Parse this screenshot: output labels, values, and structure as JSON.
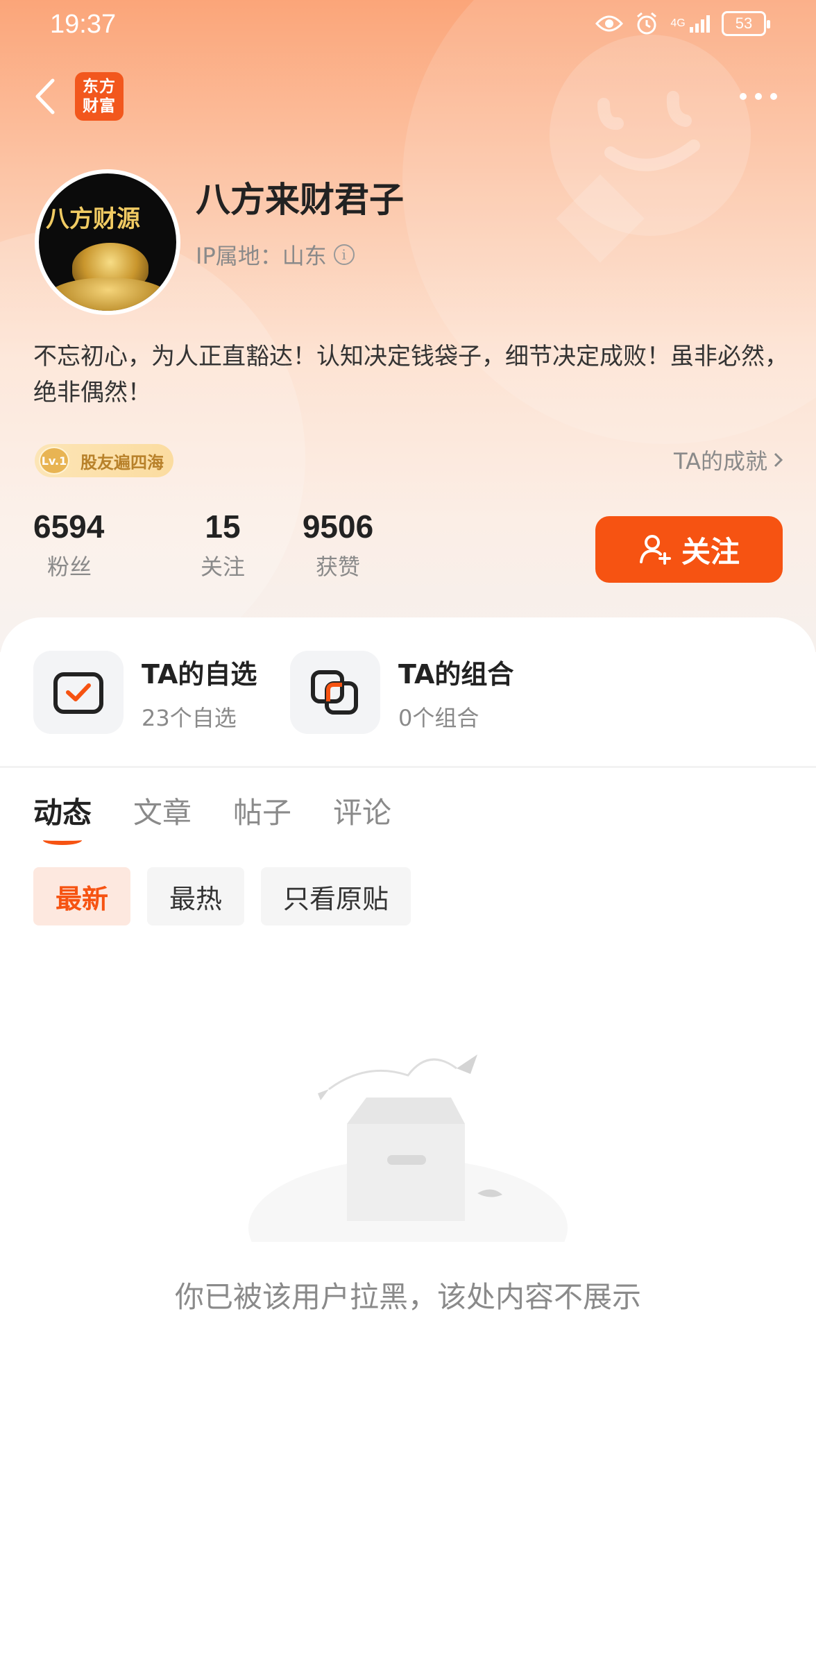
{
  "status_bar": {
    "time": "19:37",
    "network": "4G",
    "battery": "53"
  },
  "app": {
    "logo_text": "东方财富"
  },
  "profile": {
    "avatar_text": "八方财源",
    "username": "八方来财君子",
    "ip_label": "IP属地：山东",
    "bio": "不忘初心，为人正直豁达！认知决定钱袋子，细节决定成败！虽非必然，绝非偶然！",
    "badge_level": "Lv.1",
    "badge_label": "股友遍四海",
    "achievements_link": "TA的成就"
  },
  "stats": [
    {
      "value": "6594",
      "label": "粉丝"
    },
    {
      "value": "15",
      "label": "关注"
    },
    {
      "value": "9506",
      "label": "获赞"
    }
  ],
  "follow_button": "关注",
  "quick_links": {
    "watchlist": {
      "title": "TA的自选",
      "sub": "23个自选"
    },
    "portfolio": {
      "title": "TA的组合",
      "sub": "0个组合"
    }
  },
  "tabs": [
    "动态",
    "文章",
    "帖子",
    "评论"
  ],
  "active_tab": "动态",
  "filters": [
    "最新",
    "最热",
    "只看原贴"
  ],
  "active_filter": "最新",
  "empty_message": "你已被该用户拉黑，该处内容不展示",
  "colors": {
    "accent": "#f65312",
    "header_top": "#fba579",
    "header_bottom": "#f6f0ed"
  }
}
